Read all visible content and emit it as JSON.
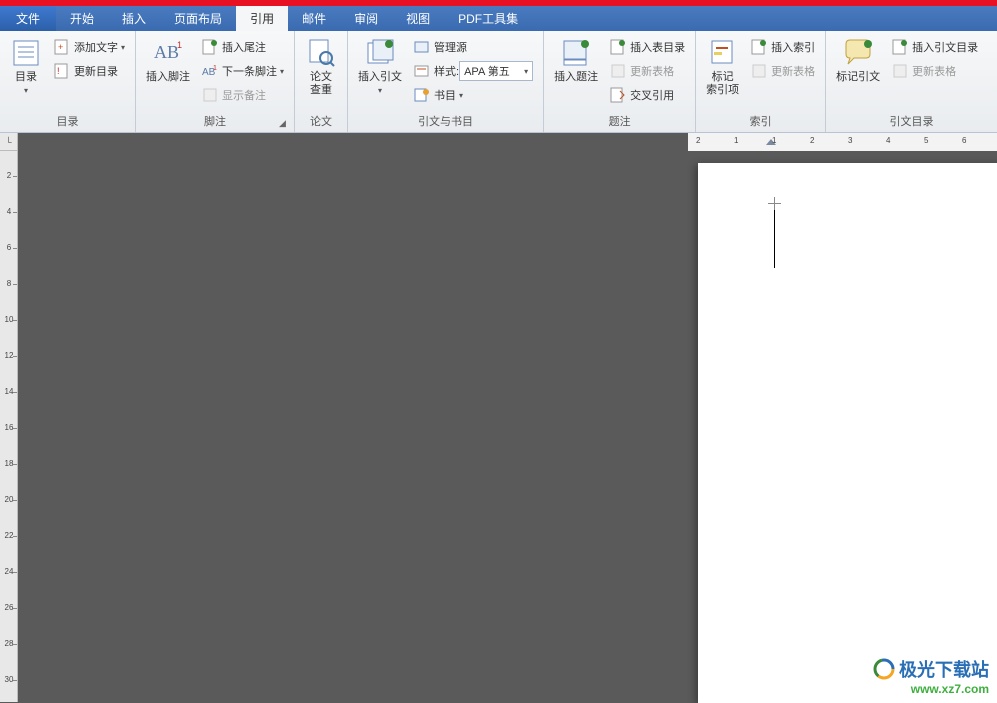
{
  "tabs": {
    "file": "文件",
    "home": "开始",
    "insert": "插入",
    "layout": "页面布局",
    "references": "引用",
    "mail": "邮件",
    "review": "审阅",
    "view": "视图",
    "pdf": "PDF工具集"
  },
  "groups": {
    "toc": {
      "label": "目录",
      "toc_btn": "目录",
      "add_text": "添加文字",
      "update_toc": "更新目录"
    },
    "footnotes": {
      "label": "脚注",
      "insert_footnote": "插入脚注",
      "insert_endnote": "插入尾注",
      "next_footnote": "下一条脚注",
      "show_notes": "显示备注"
    },
    "paper": {
      "label": "论文",
      "check": "论文\n查重"
    },
    "citations": {
      "label": "引文与书目",
      "insert_citation": "插入引文",
      "manage_sources": "管理源",
      "style_label": "样式:",
      "style_value": "APA 第五",
      "bibliography": "书目"
    },
    "captions": {
      "label": "题注",
      "insert_caption": "插入题注",
      "insert_tof": "插入表目录",
      "update_table": "更新表格",
      "cross_ref": "交叉引用"
    },
    "index": {
      "label": "索引",
      "mark_entry": "标记\n索引项",
      "insert_index": "插入索引",
      "update_table": "更新表格"
    },
    "toa": {
      "label": "引文目录",
      "mark_citation": "标记引文",
      "insert_toa": "插入引文目录",
      "update_table": "更新表格"
    }
  },
  "ruler": {
    "v": [
      "2",
      "4",
      "6",
      "8",
      "10",
      "12",
      "14",
      "16",
      "18",
      "20",
      "22",
      "24",
      "26",
      "28",
      "30"
    ],
    "h": [
      "2",
      "1",
      "1",
      "2",
      "3",
      "4",
      "5",
      "6"
    ]
  },
  "watermark": {
    "name": "极光下载站",
    "url": "www.xz7.com"
  }
}
